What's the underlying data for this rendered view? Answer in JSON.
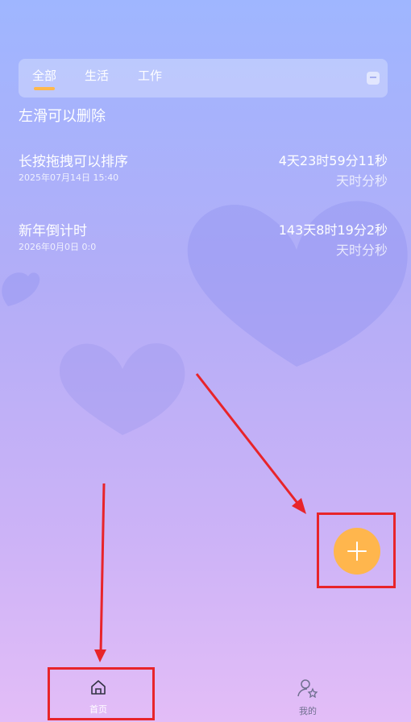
{
  "tabs": [
    {
      "label": "全部",
      "active": true
    },
    {
      "label": "生活",
      "active": false
    },
    {
      "label": "工作",
      "active": false
    }
  ],
  "hint": "左滑可以删除",
  "items": [
    {
      "title": "长按拖拽可以排序",
      "date": "2025年07月14日 15:40",
      "countdown": "4天23时59分11秒",
      "unit": "天时分秒"
    },
    {
      "title": "新年倒计时",
      "date": "2026年0月0日 0:0",
      "countdown": "143天8时19分2秒",
      "unit": "天时分秒"
    }
  ],
  "nav": {
    "home_label": "首页",
    "mine_label": "我的"
  },
  "icons": {
    "tab_menu": "list-icon",
    "fab": "plus-icon",
    "home": "home-icon",
    "mine": "user-icon"
  },
  "colors": {
    "accent": "#ffb64d",
    "annotation": "#e8242a"
  }
}
